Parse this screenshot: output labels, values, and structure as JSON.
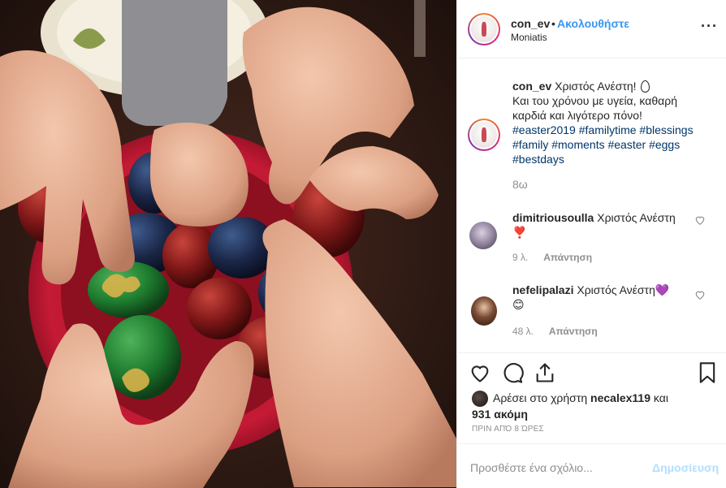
{
  "post": {
    "username": "con_ev",
    "separator": "•",
    "follow_label": "Ακολουθήστε",
    "location": "Moniatis",
    "more_icon": "more-options-icon"
  },
  "caption": {
    "username": "con_ev",
    "text_line1": "Χριστός Ανέστη!",
    "text_line2": "Και του χρόνου με υγεία, καθαρή καρδιά και λιγότερο πόνο!",
    "hashtags": "#easter2019 #familytime #blessings #family #moments #easter #eggs #bestdays",
    "time": "8ω"
  },
  "comments": [
    {
      "username": "dimitriousoulla",
      "text": "Χριστός Ανέστη",
      "emoji": "❣️",
      "time": "9 λ.",
      "reply_label": "Απάντηση"
    },
    {
      "username": "nefelipalazi",
      "text": "Χριστός Ανέστη",
      "emoji_inline": "💜",
      "emoji": "😊",
      "time": "48 λ.",
      "reply_label": "Απάντηση"
    }
  ],
  "likes": {
    "prefix": "Αρέσει στο χρήστη",
    "user": "necalex119",
    "conj": "και",
    "others": "931 ακόμη"
  },
  "posted_ago": "ΠΡΙΝ ΑΠΌ 8 ΏΡΕΣ",
  "add_comment": {
    "placeholder": "Προσθέστε ένα σχόλιο...",
    "post_label": "Δημοσίευση"
  },
  "colors": {
    "link_blue": "#3897f0",
    "hashtag": "#003569",
    "muted": "#8e8e8e",
    "post_disabled": "#b2dffc"
  }
}
